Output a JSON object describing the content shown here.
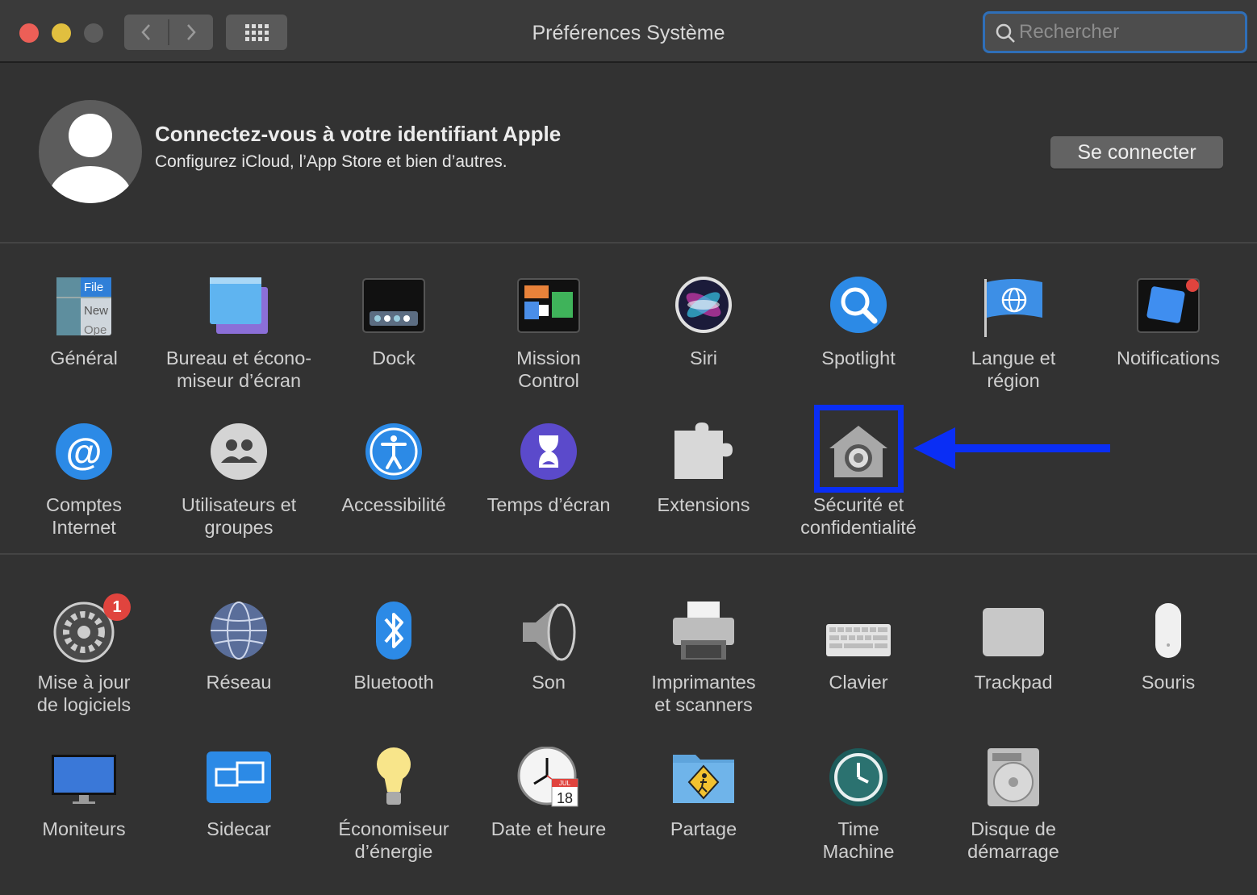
{
  "window": {
    "title": "Préférences Système"
  },
  "search": {
    "placeholder": "Rechercher"
  },
  "account": {
    "title": "Connectez-vous à votre identifiant Apple",
    "subtitle": "Configurez iCloud, l’App Store et bien d’autres.",
    "button": "Se connecter"
  },
  "row1": [
    {
      "l1": "Général",
      "l2": ""
    },
    {
      "l1": "Bureau et écono-",
      "l2": "miseur d’écran"
    },
    {
      "l1": "Dock",
      "l2": ""
    },
    {
      "l1": "Mission",
      "l2": "Control"
    },
    {
      "l1": "Siri",
      "l2": ""
    },
    {
      "l1": "Spotlight",
      "l2": ""
    },
    {
      "l1": "Langue et",
      "l2": "région"
    },
    {
      "l1": "Notifications",
      "l2": ""
    }
  ],
  "row2": [
    {
      "l1": "Comptes",
      "l2": "Internet"
    },
    {
      "l1": "Utilisateurs et",
      "l2": "groupes"
    },
    {
      "l1": "Accessibilité",
      "l2": ""
    },
    {
      "l1": "Temps d’écran",
      "l2": ""
    },
    {
      "l1": "Extensions",
      "l2": ""
    },
    {
      "l1": "Sécurité et",
      "l2": "confidentialité"
    }
  ],
  "row3": [
    {
      "l1": "Mise à jour",
      "l2": "de logiciels",
      "badge": "1"
    },
    {
      "l1": "Réseau",
      "l2": ""
    },
    {
      "l1": "Bluetooth",
      "l2": ""
    },
    {
      "l1": "Son",
      "l2": ""
    },
    {
      "l1": "Imprimantes",
      "l2": "et scanners"
    },
    {
      "l1": "Clavier",
      "l2": ""
    },
    {
      "l1": "Trackpad",
      "l2": ""
    },
    {
      "l1": "Souris",
      "l2": ""
    }
  ],
  "row4": [
    {
      "l1": "Moniteurs",
      "l2": ""
    },
    {
      "l1": "Sidecar",
      "l2": ""
    },
    {
      "l1": "Économiseur",
      "l2": "d’énergie"
    },
    {
      "l1": "Date et heure",
      "l2": ""
    },
    {
      "l1": "Partage",
      "l2": ""
    },
    {
      "l1": "Time",
      "l2": "Machine"
    },
    {
      "l1": "Disque de",
      "l2": "démarrage"
    }
  ],
  "general_icon_text": {
    "file": "File",
    "new": "New",
    "open": "Ope"
  },
  "calendar_icon": {
    "month": "JUL",
    "day": "18"
  },
  "colors": {
    "highlight": "#0a2ef5",
    "search_focus": "#2f6fb8",
    "badge": "#e0443e"
  }
}
